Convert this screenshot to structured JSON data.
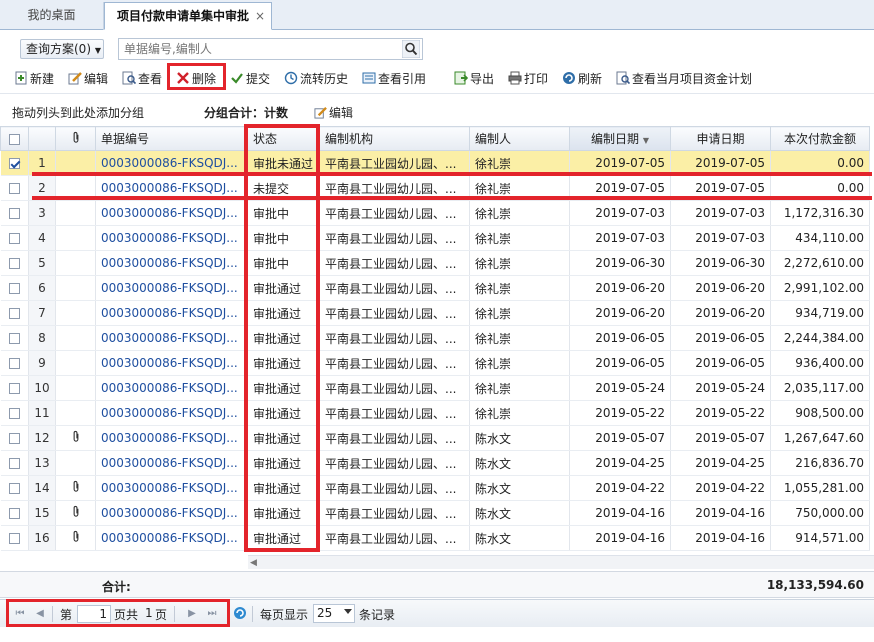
{
  "tabs": {
    "home": "我的桌面",
    "active": "项目付款申请单集中审批",
    "close": "×"
  },
  "query": {
    "scheme_label": "查询方案(0)",
    "search_placeholder": "单据编号,编制人"
  },
  "toolbar": {
    "new": "新建",
    "edit": "编辑",
    "view": "查看",
    "delete": "删除",
    "submit": "提交",
    "history": "流转历史",
    "ref": "查看引用",
    "export": "导出",
    "print": "打印",
    "refresh": "刷新",
    "plan": "查看当月项目资金计划"
  },
  "groupbar": {
    "hint": "拖动列头到此处添加分组",
    "group_total": "分组合计：计数",
    "edit": "编辑"
  },
  "columns": {
    "code": "单据编号",
    "status": "状态",
    "org": "编制机构",
    "author": "编制人",
    "made_date": "编制日期",
    "apply_date": "申请日期",
    "amount": "本次付款金额"
  },
  "rows": [
    {
      "n": "1",
      "checked": true,
      "clip": false,
      "code": "0003000086-FKSQDJ...",
      "status": "审批未通过",
      "org": "平南县工业园幼儿园、...",
      "author": "徐礼崇",
      "made": "2019-07-05",
      "apply": "2019-07-05",
      "amount": "0.00"
    },
    {
      "n": "2",
      "checked": false,
      "clip": false,
      "code": "0003000086-FKSQDJ...",
      "status": "未提交",
      "org": "平南县工业园幼儿园、...",
      "author": "徐礼崇",
      "made": "2019-07-05",
      "apply": "2019-07-05",
      "amount": "0.00"
    },
    {
      "n": "3",
      "checked": false,
      "clip": false,
      "code": "0003000086-FKSQDJ...",
      "status": "审批中",
      "org": "平南县工业园幼儿园、...",
      "author": "徐礼崇",
      "made": "2019-07-03",
      "apply": "2019-07-03",
      "amount": "1,172,316.30"
    },
    {
      "n": "4",
      "checked": false,
      "clip": false,
      "code": "0003000086-FKSQDJ...",
      "status": "审批中",
      "org": "平南县工业园幼儿园、...",
      "author": "徐礼崇",
      "made": "2019-07-03",
      "apply": "2019-07-03",
      "amount": "434,110.00"
    },
    {
      "n": "5",
      "checked": false,
      "clip": false,
      "code": "0003000086-FKSQDJ...",
      "status": "审批中",
      "org": "平南县工业园幼儿园、...",
      "author": "徐礼崇",
      "made": "2019-06-30",
      "apply": "2019-06-30",
      "amount": "2,272,610.00"
    },
    {
      "n": "6",
      "checked": false,
      "clip": false,
      "code": "0003000086-FKSQDJ...",
      "status": "审批通过",
      "org": "平南县工业园幼儿园、...",
      "author": "徐礼崇",
      "made": "2019-06-20",
      "apply": "2019-06-20",
      "amount": "2,991,102.00"
    },
    {
      "n": "7",
      "checked": false,
      "clip": false,
      "code": "0003000086-FKSQDJ...",
      "status": "审批通过",
      "org": "平南县工业园幼儿园、...",
      "author": "徐礼崇",
      "made": "2019-06-20",
      "apply": "2019-06-20",
      "amount": "934,719.00"
    },
    {
      "n": "8",
      "checked": false,
      "clip": false,
      "code": "0003000086-FKSQDJ...",
      "status": "审批通过",
      "org": "平南县工业园幼儿园、...",
      "author": "徐礼崇",
      "made": "2019-06-05",
      "apply": "2019-06-05",
      "amount": "2,244,384.00"
    },
    {
      "n": "9",
      "checked": false,
      "clip": false,
      "code": "0003000086-FKSQDJ...",
      "status": "审批通过",
      "org": "平南县工业园幼儿园、...",
      "author": "徐礼崇",
      "made": "2019-06-05",
      "apply": "2019-06-05",
      "amount": "936,400.00"
    },
    {
      "n": "10",
      "checked": false,
      "clip": false,
      "code": "0003000086-FKSQDJ...",
      "status": "审批通过",
      "org": "平南县工业园幼儿园、...",
      "author": "徐礼崇",
      "made": "2019-05-24",
      "apply": "2019-05-24",
      "amount": "2,035,117.00"
    },
    {
      "n": "11",
      "checked": false,
      "clip": false,
      "code": "0003000086-FKSQDJ...",
      "status": "审批通过",
      "org": "平南县工业园幼儿园、...",
      "author": "徐礼崇",
      "made": "2019-05-22",
      "apply": "2019-05-22",
      "amount": "908,500.00"
    },
    {
      "n": "12",
      "checked": false,
      "clip": true,
      "code": "0003000086-FKSQDJ...",
      "status": "审批通过",
      "org": "平南县工业园幼儿园、...",
      "author": "陈水文",
      "made": "2019-05-07",
      "apply": "2019-05-07",
      "amount": "1,267,647.60"
    },
    {
      "n": "13",
      "checked": false,
      "clip": false,
      "code": "0003000086-FKSQDJ...",
      "status": "审批通过",
      "org": "平南县工业园幼儿园、...",
      "author": "陈水文",
      "made": "2019-04-25",
      "apply": "2019-04-25",
      "amount": "216,836.70"
    },
    {
      "n": "14",
      "checked": false,
      "clip": true,
      "code": "0003000086-FKSQDJ...",
      "status": "审批通过",
      "org": "平南县工业园幼儿园、...",
      "author": "陈水文",
      "made": "2019-04-22",
      "apply": "2019-04-22",
      "amount": "1,055,281.00"
    },
    {
      "n": "15",
      "checked": false,
      "clip": true,
      "code": "0003000086-FKSQDJ...",
      "status": "审批通过",
      "org": "平南县工业园幼儿园、...",
      "author": "陈水文",
      "made": "2019-04-16",
      "apply": "2019-04-16",
      "amount": "750,000.00"
    },
    {
      "n": "16",
      "checked": false,
      "clip": true,
      "code": "0003000086-FKSQDJ...",
      "status": "审批通过",
      "org": "平南县工业园幼儿园、...",
      "author": "陈水文",
      "made": "2019-04-16",
      "apply": "2019-04-16",
      "amount": "914,571.00"
    }
  ],
  "totals": {
    "label": "合计:",
    "amount": "18,133,594.60"
  },
  "pager": {
    "first": "⏮",
    "prev": "◀",
    "page_prefix": "第",
    "page_value": "1",
    "page_suffix": "页共",
    "total_pages": "1",
    "pages_unit": "页",
    "next": "▶",
    "last": "⏭",
    "per_page_label": "每页显示",
    "per_page": "25",
    "records_label": "条记录"
  },
  "colors": {
    "highlight_red": "#e3242b",
    "selected_row": "#fbefa6",
    "link_blue": "#1f4fa0"
  }
}
